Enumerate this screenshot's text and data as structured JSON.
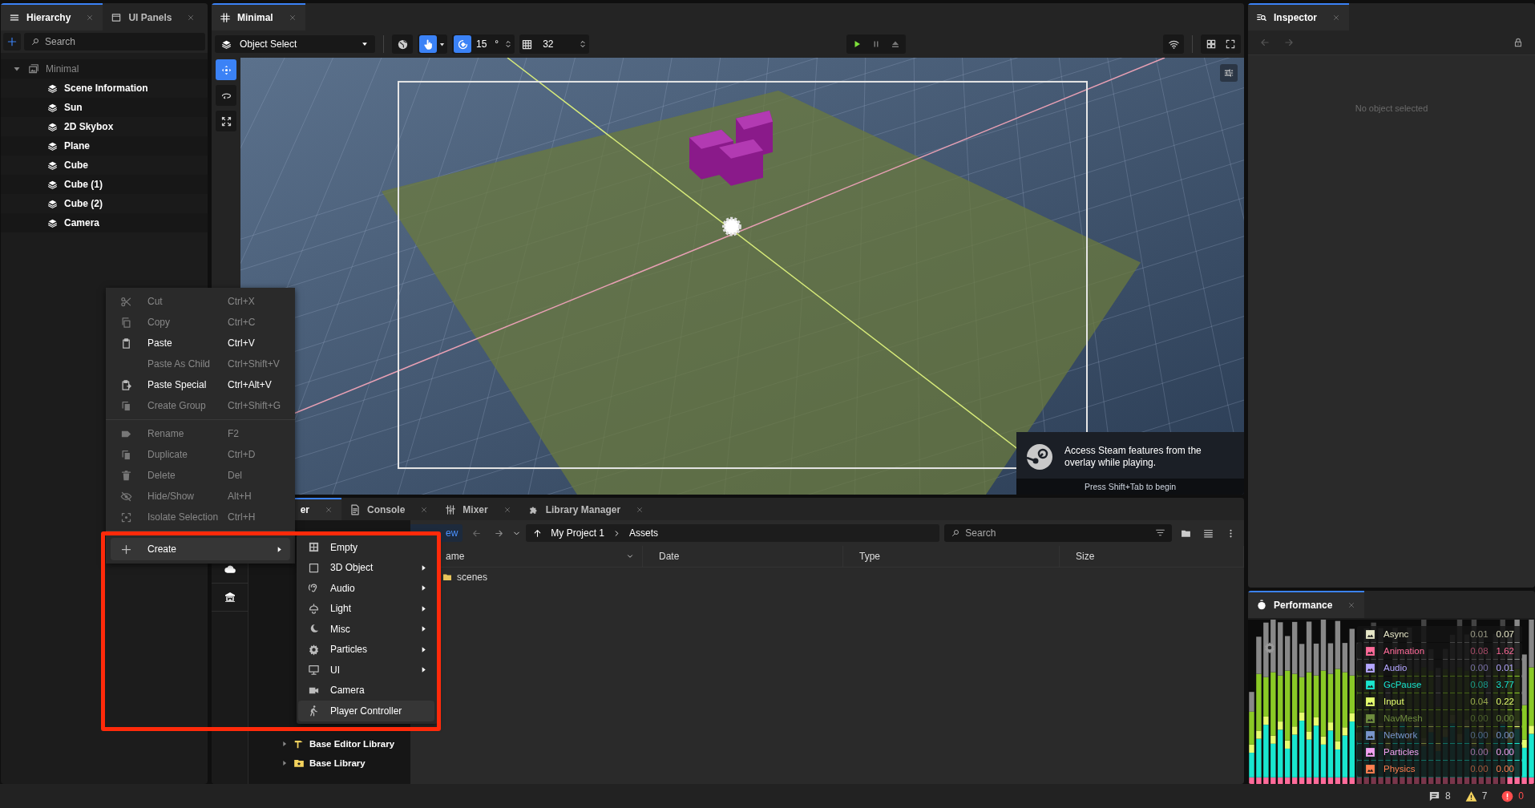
{
  "hierarchy_panel": {
    "tabs": [
      {
        "label": "Hierarchy",
        "selected": true
      },
      {
        "label": "UI Panels",
        "selected": false
      }
    ],
    "search": {
      "placeholder": "Search"
    },
    "tree": {
      "label": "Minimal",
      "expanded": true,
      "children": [
        {
          "label": "Scene Information"
        },
        {
          "label": "Sun"
        },
        {
          "label": "2D Skybox"
        },
        {
          "label": "Plane"
        },
        {
          "label": "Cube"
        },
        {
          "label": "Cube (1)"
        },
        {
          "label": "Cube (2)"
        },
        {
          "label": "Camera"
        }
      ]
    }
  },
  "scene_panel": {
    "tabs": [
      {
        "label": "Minimal",
        "selected": true
      }
    ],
    "toolbar": {
      "mode": "Object Select",
      "rotation_snap": "15",
      "degree_unit": "°",
      "grid_size": "32"
    },
    "overlay": {
      "message": "Access Steam features from the overlay while playing.",
      "hint": "Press Shift+Tab to begin"
    }
  },
  "context_menu": {
    "items": [
      {
        "kind": "item",
        "label": "Cut",
        "shortcut": "Ctrl+X",
        "disabled": true,
        "has_submenu": false,
        "selected": false
      },
      {
        "kind": "item",
        "label": "Copy",
        "shortcut": "Ctrl+C",
        "disabled": true,
        "has_submenu": false,
        "selected": false
      },
      {
        "kind": "item",
        "label": "Paste",
        "shortcut": "Ctrl+V",
        "disabled": false,
        "has_submenu": false,
        "selected": false
      },
      {
        "kind": "item",
        "label": "Paste As Child",
        "shortcut": "Ctrl+Shift+V",
        "disabled": true,
        "has_submenu": false,
        "selected": false
      },
      {
        "kind": "item",
        "label": "Paste Special",
        "shortcut": "Ctrl+Alt+V",
        "disabled": false,
        "has_submenu": false,
        "selected": false
      },
      {
        "kind": "item",
        "label": "Create Group",
        "shortcut": "Ctrl+Shift+G",
        "disabled": true,
        "has_submenu": false,
        "selected": false
      },
      {
        "kind": "separator"
      },
      {
        "kind": "item",
        "label": "Rename",
        "shortcut": "F2",
        "disabled": true,
        "has_submenu": false,
        "selected": false
      },
      {
        "kind": "item",
        "label": "Duplicate",
        "shortcut": "Ctrl+D",
        "disabled": true,
        "has_submenu": false,
        "selected": false
      },
      {
        "kind": "item",
        "label": "Delete",
        "shortcut": "Del",
        "disabled": true,
        "has_submenu": false,
        "selected": false
      },
      {
        "kind": "item",
        "label": "Hide/Show",
        "shortcut": "Alt+H",
        "disabled": true,
        "has_submenu": false,
        "selected": false
      },
      {
        "kind": "item",
        "label": "Isolate Selection",
        "shortcut": "Ctrl+H",
        "disabled": true,
        "has_submenu": false,
        "selected": false
      },
      {
        "kind": "separator"
      },
      {
        "kind": "item",
        "label": "Create",
        "disabled": false,
        "has_submenu": true,
        "selected": true
      }
    ]
  },
  "create_submenu": {
    "items": [
      {
        "label": "Empty",
        "has_submenu": false,
        "selected": false
      },
      {
        "label": "3D Object",
        "has_submenu": true,
        "selected": false
      },
      {
        "label": "Audio",
        "has_submenu": true,
        "selected": false
      },
      {
        "label": "Light",
        "has_submenu": true,
        "selected": false
      },
      {
        "label": "Misc",
        "has_submenu": true,
        "selected": false
      },
      {
        "label": "Particles",
        "has_submenu": true,
        "selected": false
      },
      {
        "label": "UI",
        "has_submenu": true,
        "selected": false
      },
      {
        "label": "Camera",
        "has_submenu": false,
        "selected": false
      },
      {
        "label": "Player Controller",
        "has_submenu": false,
        "selected": true
      }
    ]
  },
  "bottom_panel": {
    "tabs": [
      {
        "label": "er",
        "selected": true
      },
      {
        "label": "Console",
        "selected": false
      },
      {
        "label": "Mixer",
        "selected": false
      },
      {
        "label": "Library Manager",
        "selected": false
      }
    ],
    "library_tree": [
      {
        "label": "Base Editor Library",
        "expanded": false
      },
      {
        "label": "Base Library",
        "expanded": false
      }
    ],
    "new_button": "ew",
    "breadcrumb": [
      "My Project 1",
      "Assets"
    ],
    "search": {
      "placeholder": "Search"
    },
    "columns": [
      "ame",
      "Date",
      "Type",
      "Size"
    ],
    "rows": [
      {
        "name": "scenes"
      }
    ]
  },
  "inspector": {
    "tabs": [
      {
        "label": "Inspector",
        "selected": true
      }
    ],
    "empty_message": "No object selected"
  },
  "performance": {
    "tabs": [
      {
        "label": "Performance",
        "selected": true
      }
    ],
    "metrics": [
      {
        "name": "Async",
        "average": "0.01",
        "current": "0.07",
        "color": "#e8e8c8"
      },
      {
        "name": "Animation",
        "average": "0.08",
        "current": "1.62",
        "color": "#ff6b9a"
      },
      {
        "name": "Audio",
        "average": "0.00",
        "current": "0.01",
        "color": "#b4a6ff"
      },
      {
        "name": "GcPause",
        "average": "0.08",
        "current": "3.77",
        "color": "#19e6cf"
      },
      {
        "name": "Input",
        "average": "0.04",
        "current": "0.22",
        "color": "#e6ff70"
      },
      {
        "name": "NavMesh",
        "average": "0.00",
        "current": "0.00",
        "color": "#6e8c3e"
      },
      {
        "name": "Network",
        "average": "0.00",
        "current": "0.00",
        "color": "#7896cc"
      },
      {
        "name": "Particles",
        "average": "0.00",
        "current": "0.00",
        "color": "#f2a2f2"
      },
      {
        "name": "Physics",
        "average": "0.00",
        "current": "0.00",
        "color": "#ff7f50"
      }
    ]
  },
  "status_bar": {
    "messages": "8",
    "warnings": "7",
    "errors": "0"
  }
}
